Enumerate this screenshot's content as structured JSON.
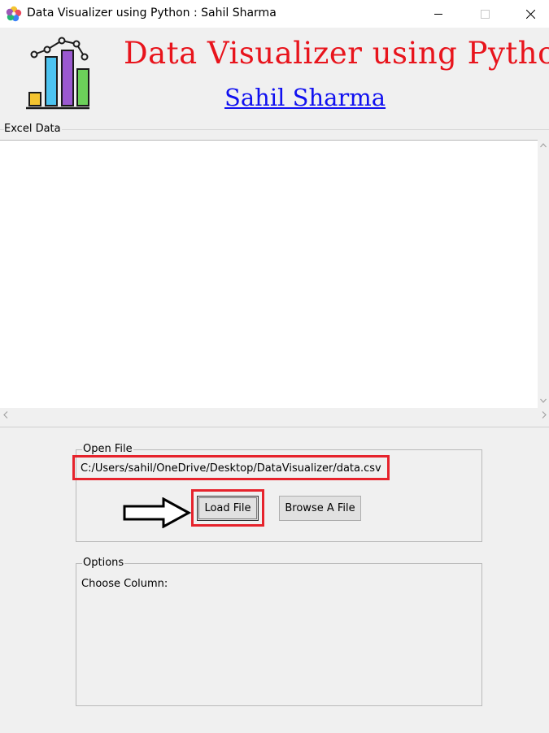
{
  "window": {
    "title": "Data Visualizer using Python : Sahil Sharma",
    "icon": "app-flower-icon",
    "controls": [
      "minimize-icon",
      "maximize-icon",
      "close-icon"
    ]
  },
  "header": {
    "logo": "bar-chart-logo-icon",
    "title": "Data Visualizer using Python",
    "author": "Sahil Sharma",
    "title_color": "#e8141c",
    "author_color": "#1010f0"
  },
  "excel_data": {
    "label": "Excel Data"
  },
  "open_file": {
    "label": "Open File",
    "path": "C:/Users/sahil/OneDrive/Desktop/DataVisualizer/data.csv",
    "load_button": "Load File",
    "browse_button": "Browse A File"
  },
  "options": {
    "label": "Options",
    "choose_column_label": "Choose Column:"
  },
  "annotations": {
    "highlight_color": "#e6232c",
    "arrow": "right-pointing-arrow-icon"
  }
}
